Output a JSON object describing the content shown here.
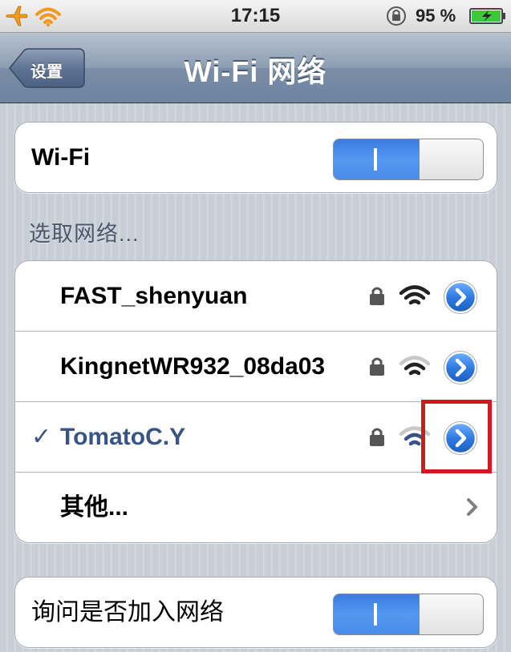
{
  "status_bar": {
    "time": "17:15",
    "battery_percent": "95 %",
    "icons": [
      "airplane-icon",
      "wifi-icon",
      "rotation-lock-icon",
      "battery-charging-icon"
    ]
  },
  "nav": {
    "back_label": "设置",
    "title": "Wi-Fi 网络"
  },
  "wifi_group": {
    "label": "Wi-Fi",
    "toggle_on": true
  },
  "networks_header": "选取网络...",
  "networks": [
    {
      "name": "FAST_shenyuan",
      "selected": false,
      "locked": true,
      "signal": 3
    },
    {
      "name": "KingnetWR932_08da03",
      "selected": false,
      "locked": true,
      "signal": 2
    },
    {
      "name": "TomatoC.Y",
      "selected": true,
      "locked": true,
      "signal": 2
    }
  ],
  "checkmark": "✓",
  "other_label": "其他...",
  "ask_group": {
    "label": "询问是否加入网络",
    "toggle_on": true
  },
  "colors": {
    "accent_blue": "#4a8be8",
    "selected_text": "#385487",
    "highlight": "#d41820"
  }
}
